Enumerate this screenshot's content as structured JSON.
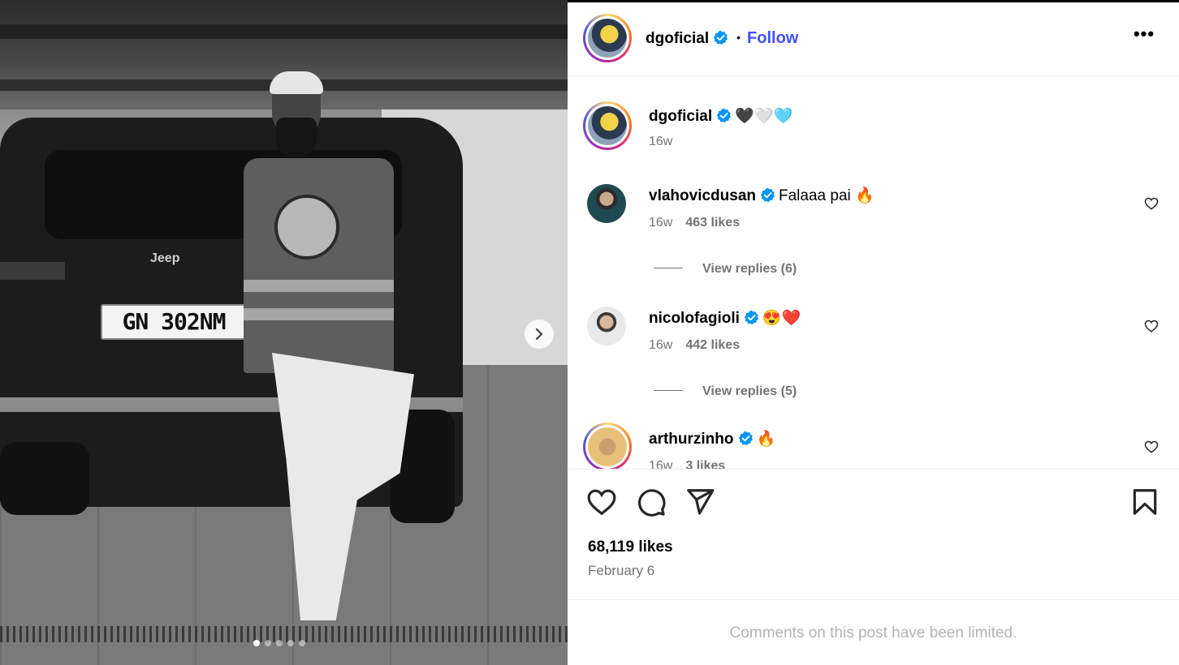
{
  "post": {
    "image": {
      "plate_text": "GN 302NM",
      "car_brand": "Jeep",
      "carousel_dots": 5,
      "active_dot": 1,
      "next_icon": "chevron-right-icon"
    },
    "author": {
      "username": "dgoficial",
      "verified": true,
      "separator": "•",
      "follow_label": "Follow",
      "more_icon": "more-options-icon",
      "more_label": "•••"
    },
    "caption": {
      "username": "dgoficial",
      "text": "🖤🤍🩵",
      "time": "16w"
    },
    "comments": [
      {
        "username": "vlahovicdusan",
        "verified": true,
        "text": "Falaaa pai 🔥",
        "time": "16w",
        "likes": "463 likes",
        "replies": "View replies (6)"
      },
      {
        "username": "nicolofagioli",
        "verified": true,
        "text": "😍❤️",
        "time": "16w",
        "likes": "442 likes",
        "replies": "View replies (5)"
      },
      {
        "username": "arthurzinho",
        "verified": true,
        "text": "🔥",
        "time": "16w",
        "likes": "3 likes"
      }
    ],
    "actions": {
      "like_icon": "heart-icon",
      "comment_icon": "comment-icon",
      "share_icon": "share-icon",
      "save_icon": "bookmark-icon"
    },
    "likes_count": "68,119 likes",
    "date": "February 6",
    "comments_limited": "Comments on this post have been limited."
  },
  "colors": {
    "follow_blue": "#4150f7",
    "verified_blue": "#0095f6",
    "muted_gray": "#737373"
  }
}
